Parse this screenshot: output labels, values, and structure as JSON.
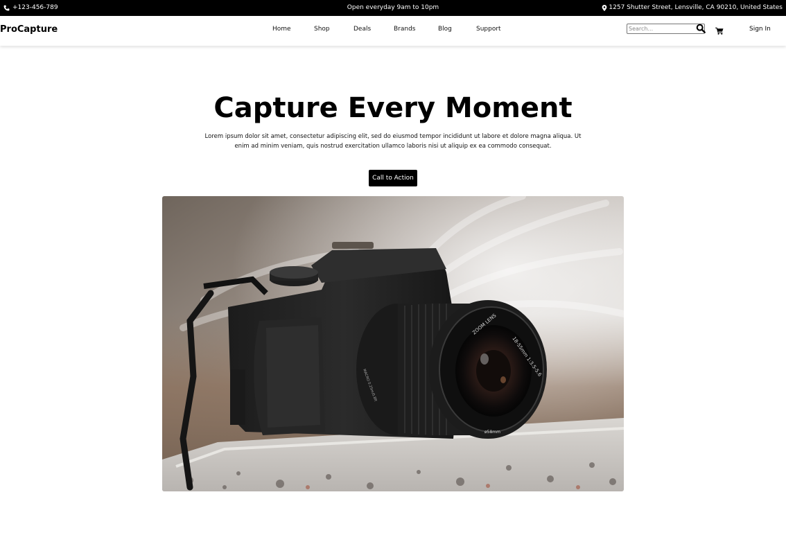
{
  "topbar": {
    "phone": "+123-456-789",
    "hours": "Open everyday 9am to 10pm",
    "address": "1257 Shutter Street, Lensville, CA 90210, United States",
    "phone_icon": "phone-icon",
    "location_icon": "map-marker-icon"
  },
  "navbar": {
    "brand": "ProCapture",
    "links": [
      "Home",
      "Shop",
      "Deals",
      "Brands",
      "Blog",
      "Support"
    ],
    "search_placeholder": "Search...",
    "search_icon": "search-icon",
    "cart_icon": "shopping-cart-icon",
    "signin": "Sign In"
  },
  "hero": {
    "title": "Capture Every Moment",
    "description": "Lorem ipsum dolor sit amet, consectetur adipiscing elit, sed do eiusmod tempor incididunt ut labore et dolore magna aliqua. Ut enim ad minim veniam, quis nostrud exercitation ullamco laboris nisi ut aliquip ex ea commodo consequat.",
    "cta_label": "Call to Action",
    "image_subject": "dslr-camera-photo",
    "lens_text_1": "ZOOM LENS",
    "lens_text_2": "18-55mm 1:3.5-5.6",
    "lens_text_3": "ø58mm",
    "lens_text_4": "MACRO 0.25m/0.8ft"
  },
  "colors": {
    "topbar_bg": "#000000",
    "cta_bg": "#000000",
    "page_bg": "#ffffff"
  }
}
